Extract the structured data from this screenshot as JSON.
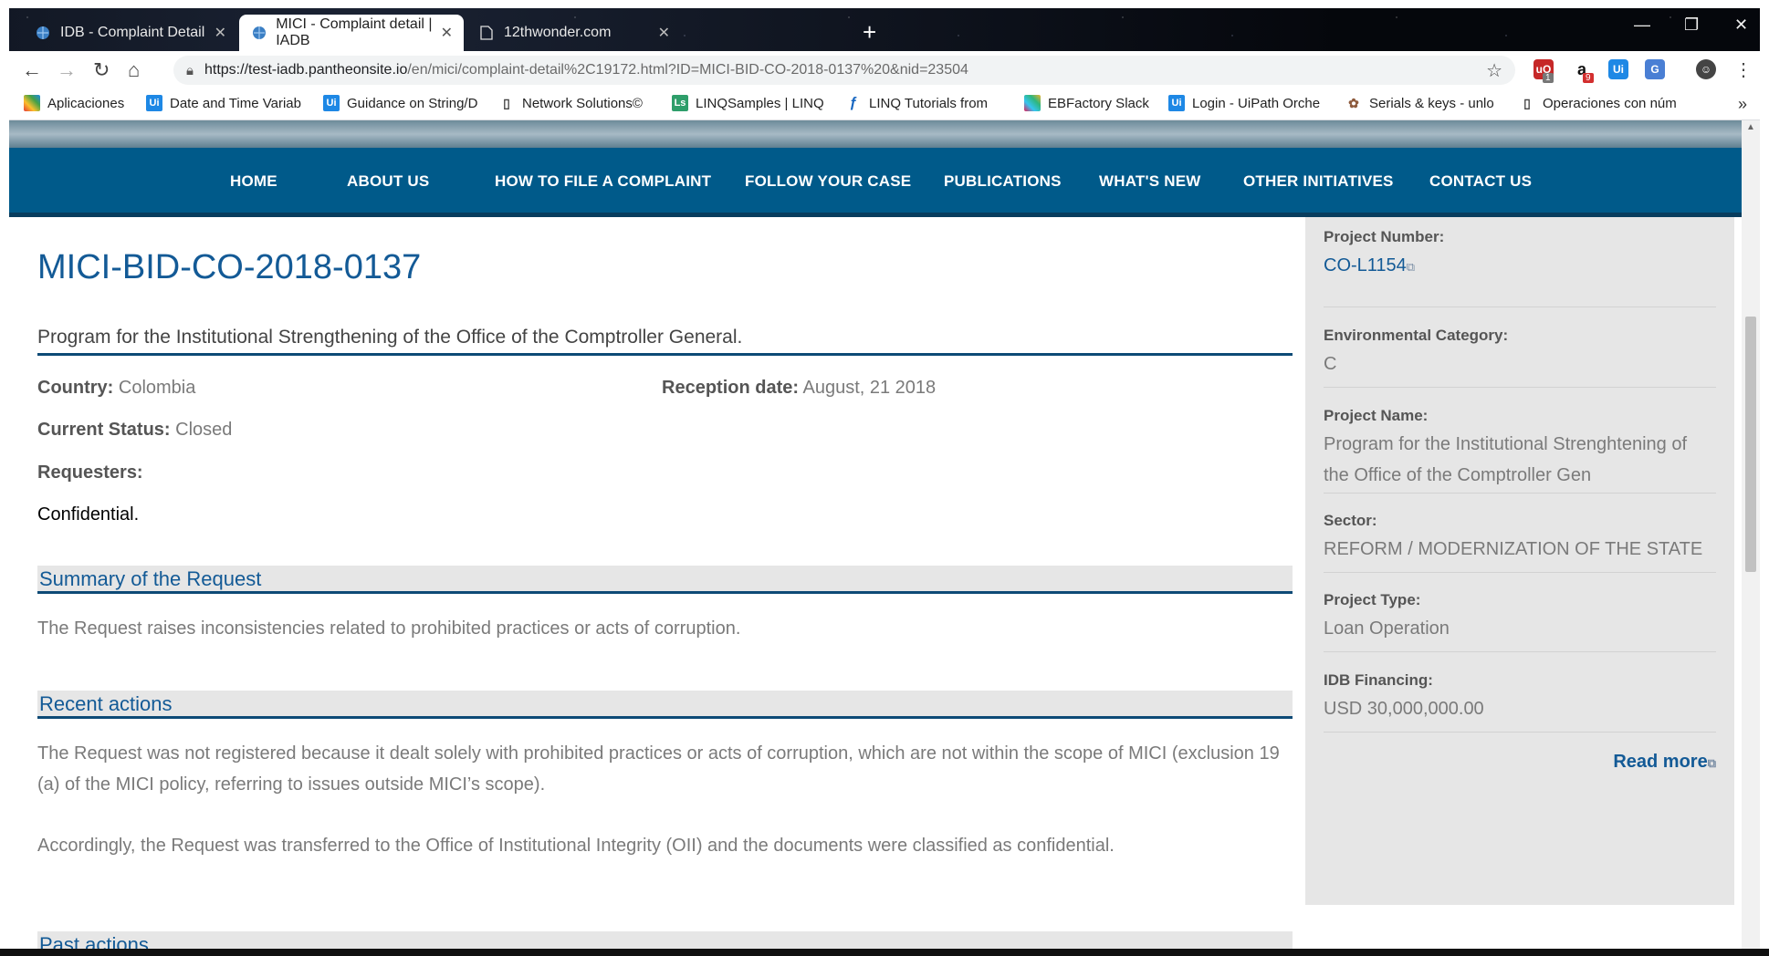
{
  "browser": {
    "tabs": [
      {
        "title": "IDB - Complaint Detail",
        "active": false
      },
      {
        "title": "MICI - Complaint detail | IADB",
        "active": true
      },
      {
        "title": "12thwonder.com",
        "active": false
      }
    ],
    "url_host": "https://test-iadb.pantheonsite.io",
    "url_path": "/en/mici/complaint-detail%2C19172.html?ID=MICI-BID-CO-2018-0137%20&nid=23504",
    "extension_badges": [
      "1",
      "9"
    ],
    "bookmarks": [
      "Aplicaciones",
      "Date and Time Variab",
      "Guidance on String/D",
      "Network Solutions©",
      "LINQSamples | LINQ",
      "LINQ Tutorials from",
      "EBFactory Slack",
      "Login - UiPath Orche",
      "Serials & keys - unlo",
      "Operaciones con núm"
    ]
  },
  "nav": {
    "items": [
      "HOME",
      "ABOUT US",
      "HOW TO FILE A COMPLAINT",
      "FOLLOW YOUR CASE",
      "PUBLICATIONS",
      "WHAT'S NEW",
      "OTHER INITIATIVES",
      "CONTACT US"
    ]
  },
  "case": {
    "id": "MICI-BID-CO-2018-0137",
    "title": "Program for the Institutional Strengthening of the Office of the Comptroller General.",
    "country_label": "Country:",
    "country": "Colombia",
    "reception_label": "Reception date:",
    "reception": "August, 21 2018",
    "status_label": "Current Status:",
    "status": "Closed",
    "requesters_label": "Requesters:",
    "requesters": "Confidential."
  },
  "sections": {
    "summary_title": "Summary of the Request",
    "summary_text": "The Request raises inconsistencies related to prohibited practices or acts of corruption.",
    "recent_title": "Recent actions",
    "recent_text_1": "The Request was not registered because it dealt solely with prohibited practices or acts of corruption, which are not within the scope of MICI (exclusion 19 (a) of the MICI policy, referring to issues outside MICI’s scope).",
    "recent_text_2": "Accordingly, the Request was transferred to the Office of Institutional Integrity (OII) and the documents were classified as confidential.",
    "past_title": "Past actions"
  },
  "sidebar": {
    "project_number_label": "Project Number:",
    "project_number": "CO-L1154",
    "env_label": "Environmental Category:",
    "env": "C",
    "name_label": "Project Name:",
    "name": "Program for the Institutional Strenghtening of the Office of the Comptroller Gen",
    "sector_label": "Sector:",
    "sector": "REFORM / MODERNIZATION OF THE STATE",
    "type_label": "Project Type:",
    "type": "Loan Operation",
    "financing_label": "IDB Financing:",
    "financing": "USD 30,000,000.00",
    "read_more": "Read more"
  }
}
